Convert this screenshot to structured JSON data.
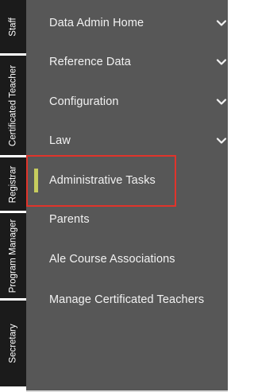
{
  "side_tabs": [
    {
      "label": "Staff"
    },
    {
      "label": "Certificated Teacher"
    },
    {
      "label": "Registrar"
    },
    {
      "label": "Program Manager"
    },
    {
      "label": "Secretary"
    }
  ],
  "menu": {
    "items": [
      {
        "label": "Data Admin Home",
        "has_submenu": true
      },
      {
        "label": "Reference Data",
        "has_submenu": true
      },
      {
        "label": "Configuration",
        "has_submenu": true
      },
      {
        "label": "Law",
        "has_submenu": true
      },
      {
        "label": "Administrative Tasks",
        "has_submenu": false,
        "active": true,
        "highlighted": true
      },
      {
        "label": "Parents",
        "has_submenu": false
      },
      {
        "label": "Ale Course Associations",
        "has_submenu": false
      },
      {
        "label": "Manage Certificated Teachers",
        "has_submenu": false
      }
    ]
  },
  "colors": {
    "panel_background": "#575757",
    "tab_background": "#1b1b1b",
    "active_indicator": "#c7cc5e",
    "highlight_border": "#e0342b",
    "text": "#f2f2f2"
  },
  "icons": {
    "submenu": "chevron-down-icon"
  }
}
